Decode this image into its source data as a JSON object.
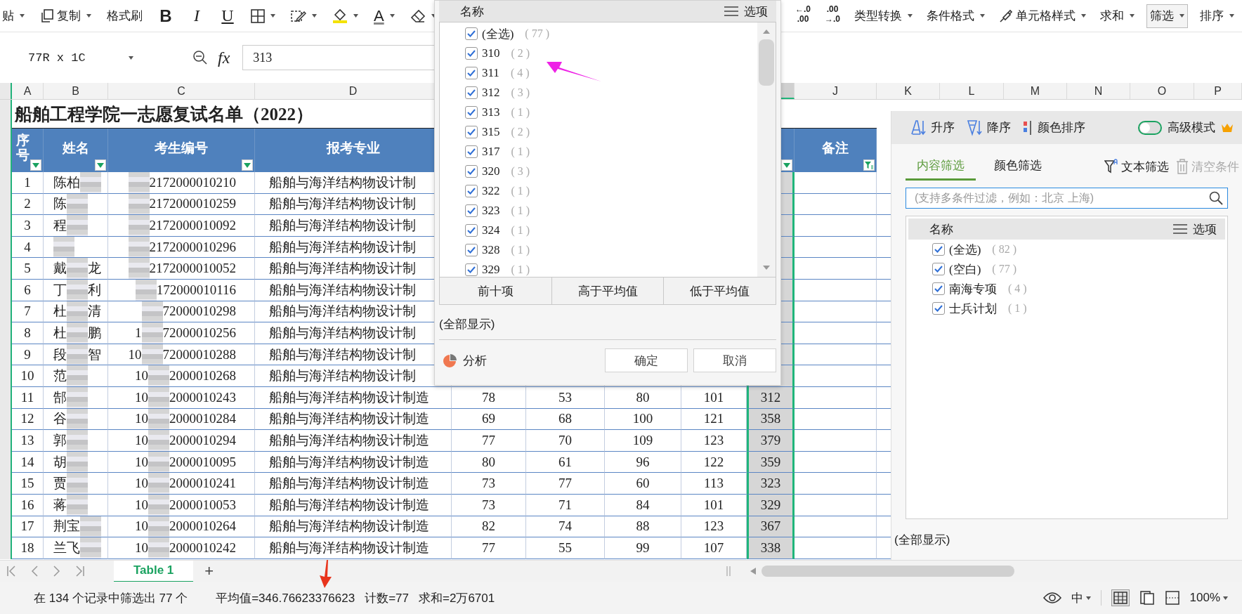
{
  "ribbon": {
    "left": [
      {
        "kind": "text",
        "label": "贴",
        "dropdown": true
      },
      {
        "kind": "copy",
        "label": "复制",
        "dropdown": true
      },
      {
        "kind": "text",
        "label": "格式刷",
        "dropdown": false
      },
      {
        "kind": "bold",
        "label": "B",
        "dropdown": false
      },
      {
        "kind": "italic",
        "label": "I",
        "dropdown": false
      },
      {
        "kind": "underline",
        "label": "U",
        "dropdown": false
      },
      {
        "kind": "border",
        "dropdown": true
      },
      {
        "kind": "edit",
        "dropdown": true
      },
      {
        "kind": "fill",
        "dropdown": true
      },
      {
        "kind": "fontcolor",
        "label": "A",
        "dropdown": true
      },
      {
        "kind": "eraser",
        "dropdown": true
      }
    ],
    "right": [
      {
        "kind": "stacked",
        "top": "←.0",
        "bottom": ".00",
        "selected": false
      },
      {
        "kind": "stacked",
        "top": ".00",
        "bottom": "→.0",
        "selected": false
      },
      {
        "kind": "text",
        "label": "类型转换",
        "dropdown": true,
        "selected": false
      },
      {
        "kind": "text",
        "label": "条件格式",
        "dropdown": true,
        "selected": false
      },
      {
        "kind": "brush",
        "label": "单元格样式",
        "dropdown": true,
        "selected": false
      },
      {
        "kind": "text",
        "label": "求和",
        "dropdown": true,
        "selected": false
      },
      {
        "kind": "text",
        "label": "筛选",
        "dropdown": true,
        "selected": true
      },
      {
        "kind": "text",
        "label": "排序",
        "dropdown": true,
        "selected": false
      }
    ]
  },
  "formula_bar": {
    "name_box": "77R x 1C",
    "fx": "fx",
    "value": "313"
  },
  "sheet": {
    "columns": [
      {
        "letter": "A",
        "selected": false
      },
      {
        "letter": "B",
        "selected": false
      },
      {
        "letter": "C",
        "selected": false
      },
      {
        "letter": "D",
        "selected": false
      },
      {
        "selected": true
      },
      {
        "letter": "J",
        "selected": false
      },
      {
        "letter": "K",
        "selected": false
      },
      {
        "letter": "L",
        "selected": false
      },
      {
        "letter": "M",
        "selected": false
      },
      {
        "letter": "N",
        "selected": false
      },
      {
        "letter": "O",
        "selected": false
      },
      {
        "letter": "P",
        "selected": false
      }
    ],
    "title": "船舶工程学院一志愿复试名单（2022）",
    "header_cells": [
      {
        "label": "序号",
        "kind": "filter"
      },
      {
        "label": "姓名",
        "kind": "filter"
      },
      {
        "label": "考生编号",
        "kind": "filter"
      },
      {
        "label": "报考专业",
        "kind": "plain"
      },
      {
        "kind": "filter"
      },
      {
        "label": "备注",
        "kind": "filtered"
      }
    ],
    "rows": [
      {
        "seq": "1",
        "name_head": "陈柏",
        "id_tail": "2172000010210",
        "major": "船舶与海洋结构物设计制"
      },
      {
        "seq": "2",
        "name_head": "陈",
        "id_tail": "2172000010259",
        "major": "船舶与海洋结构物设计制"
      },
      {
        "seq": "3",
        "name_head": "程",
        "id_tail": "2172000010092",
        "major": "船舶与海洋结构物设计制"
      },
      {
        "seq": "4",
        "id_tail": "2172000010296",
        "major": "船舶与海洋结构物设计制"
      },
      {
        "seq": "5",
        "name_head": "戴",
        "name_tail": "龙",
        "id_tail": "2172000010052",
        "major": "船舶与海洋结构物设计制"
      },
      {
        "seq": "6",
        "name_head": "丁",
        "name_tail": "利",
        "id_tail": "172000010116",
        "major": "船舶与海洋结构物设计制"
      },
      {
        "seq": "7",
        "name_head": "杜",
        "name_tail": "清",
        "id_tail": "72000010298",
        "major": "船舶与海洋结构物设计制"
      },
      {
        "seq": "8",
        "name_head": "杜",
        "name_tail": "鹏",
        "id_head": "1",
        "id_tail": "72000010256",
        "major": "船舶与海洋结构物设计制"
      },
      {
        "seq": "9",
        "name_head": "段",
        "name_tail": "智",
        "id_head": "10",
        "id_tail": "72000010288",
        "major": "船舶与海洋结构物设计制"
      },
      {
        "seq": "10",
        "name_head": "范",
        "id_head": "10",
        "id_tail": "2000010268",
        "major": "船舶与海洋结构物设计制"
      },
      {
        "seq": "11",
        "name_head": "郜",
        "id_head": "10",
        "id_tail": "2000010243",
        "major": "船舶与海洋结构物设计制造",
        "scores": [
          "78",
          "53",
          "80",
          "101"
        ],
        "total": "312"
      },
      {
        "seq": "12",
        "name_head": "谷",
        "id_head": "10",
        "id_tail": "2000010284",
        "major": "船舶与海洋结构物设计制造",
        "scores": [
          "69",
          "68",
          "100",
          "121"
        ],
        "total": "358"
      },
      {
        "seq": "13",
        "name_head": "郭",
        "id_head": "10",
        "id_tail": "2000010294",
        "major": "船舶与海洋结构物设计制造",
        "scores": [
          "77",
          "70",
          "109",
          "123"
        ],
        "total": "379"
      },
      {
        "seq": "14",
        "name_head": "胡",
        "id_head": "10",
        "id_tail": "2000010095",
        "major": "船舶与海洋结构物设计制造",
        "scores": [
          "80",
          "61",
          "96",
          "122"
        ],
        "total": "359"
      },
      {
        "seq": "15",
        "name_head": "贾",
        "id_head": "10",
        "id_tail": "2000010241",
        "major": "船舶与海洋结构物设计制造",
        "scores": [
          "73",
          "77",
          "60",
          "113"
        ],
        "total": "323"
      },
      {
        "seq": "16",
        "name_head": "蒋",
        "id_head": "10",
        "id_tail": "2000010053",
        "major": "船舶与海洋结构物设计制造",
        "scores": [
          "73",
          "71",
          "84",
          "101"
        ],
        "total": "329"
      },
      {
        "seq": "17",
        "name_head": "荆宝",
        "id_head": "10",
        "id_tail": "2000010264",
        "major": "船舶与海洋结构物设计制造",
        "scores": [
          "82",
          "74",
          "88",
          "123"
        ],
        "total": "367"
      },
      {
        "seq": "18",
        "name_head": "兰飞",
        "id_head": "10",
        "id_tail": "2000010242",
        "major": "船舶与海洋结构物设计制造",
        "scores": [
          "77",
          "55",
          "99",
          "107"
        ],
        "total": "338"
      }
    ]
  },
  "filter_dropdown": {
    "header": {
      "label": "名称",
      "options": "选项"
    },
    "items": [
      {
        "label": "(全选)",
        "count": "( 77 )",
        "checked": true
      },
      {
        "label": "310",
        "count": "( 2 )",
        "checked": true
      },
      {
        "label": "311",
        "count": "( 4 )",
        "checked": true
      },
      {
        "label": "312",
        "count": "( 3 )",
        "checked": true
      },
      {
        "label": "313",
        "count": "( 1 )",
        "checked": true
      },
      {
        "label": "315",
        "count": "( 2 )",
        "checked": true
      },
      {
        "label": "317",
        "count": "( 1 )",
        "checked": true
      },
      {
        "label": "320",
        "count": "( 3 )",
        "checked": true
      },
      {
        "label": "322",
        "count": "( 1 )",
        "checked": true
      },
      {
        "label": "323",
        "count": "( 1 )",
        "checked": true
      },
      {
        "label": "324",
        "count": "( 1 )",
        "checked": true
      },
      {
        "label": "328",
        "count": "( 1 )",
        "checked": true
      },
      {
        "label": "329",
        "count": "( 1 )",
        "checked": true
      }
    ],
    "quick_buttons": [
      "前十项",
      "高于平均值",
      "低于平均值"
    ],
    "show_all": "(全部显示)",
    "analysis": "分析",
    "ok": "确定",
    "cancel": "取消",
    "annotation": {
      "color": "#ee22e6"
    }
  },
  "filter_panel": {
    "sort_buttons": [
      {
        "kind": "asc",
        "label": "升序"
      },
      {
        "kind": "desc",
        "label": "降序"
      },
      {
        "kind": "color",
        "label": "颜色排序"
      }
    ],
    "advanced": {
      "label": "高级模式",
      "on": false
    },
    "tabs": [
      {
        "label": "内容筛选",
        "selected": true
      },
      {
        "label": "颜色筛选",
        "selected": false
      }
    ],
    "text_filter": "文本筛选",
    "clear": {
      "label": "清空条件",
      "disabled": true
    },
    "search": {
      "placeholder": "(支持多条件过滤，例如：北京 上海)"
    },
    "list_header": {
      "label": "名称",
      "options": "选项"
    },
    "items": [
      {
        "label": "(全选)",
        "count": "( 82 )",
        "checked": true
      },
      {
        "label": "(空白)",
        "count": "( 77 )",
        "checked": true
      },
      {
        "label": "南海专项",
        "count": "( 4 )",
        "checked": true
      },
      {
        "label": "士兵计划",
        "count": "( 1 )",
        "checked": true
      }
    ],
    "show_all": "(全部显示)"
  },
  "sheet_tabs": {
    "tabs": [
      {
        "label": "Table 1",
        "selected": true
      }
    ],
    "add": "+"
  },
  "status_bar": {
    "summary": "在 134 个记录中筛选出 77 个",
    "average": "平均值=346.76623376623",
    "count": "计数=77",
    "sum": "求和=2万6701",
    "ime": "中",
    "zoom": "100%",
    "annotation": {
      "color": "#e8341c"
    }
  }
}
